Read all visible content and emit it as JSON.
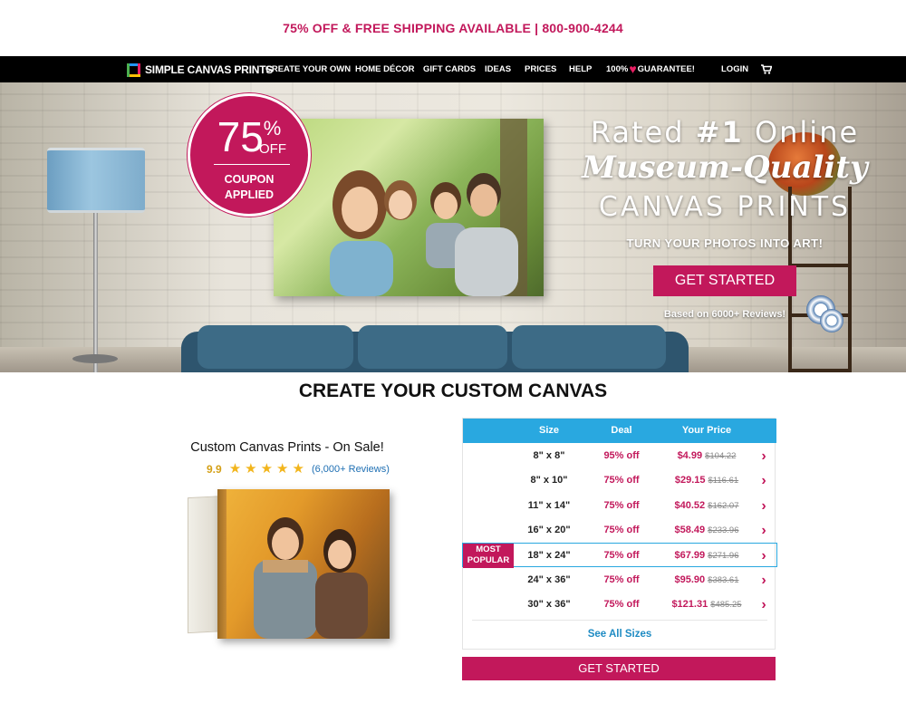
{
  "promo": {
    "text": "75% OFF & FREE SHIPPING AVAILABLE | 800-900-4244"
  },
  "nav": {
    "logo_text": "SIMPLE CANVAS PRINTS",
    "items": [
      "CREATE YOUR OWN",
      "HOME DÉCOR",
      "GIFT CARDS",
      "IDEAS",
      "PRICES",
      "HELP"
    ],
    "guarantee_prefix": "100%",
    "guarantee_suffix": "GUARANTEE!",
    "login": "LOGIN",
    "cart_icon": "cart-icon"
  },
  "hero": {
    "badge_number": "75",
    "badge_percent": "%",
    "badge_off": "OFF",
    "badge_coupon_line1": "COUPON",
    "badge_coupon_line2": "APPLIED",
    "line1_prefix": "Rated ",
    "line1_bold": "#1",
    "line1_suffix": " Online",
    "line2": "Museum-Quality",
    "line3": "CANVAS PRINTS",
    "tagline": "TURN YOUR PHOTOS INTO ART!",
    "cta": "GET STARTED",
    "reviews": "Based on 6000+ Reviews!"
  },
  "section_title": "CREATE YOUR CUSTOM CANVAS",
  "product": {
    "title": "Custom Canvas Prints - On Sale!",
    "rating_score": "9.9",
    "stars": 5,
    "review_count": "(6,000+ Reviews)"
  },
  "pricing": {
    "headers": {
      "size": "Size",
      "deal": "Deal",
      "price": "Your Price"
    },
    "rows": [
      {
        "size": "8\" x 8\"",
        "deal": "95% off",
        "price": "$4.99",
        "old": "$104.22",
        "popular": false
      },
      {
        "size": "8\" x 10\"",
        "deal": "75% off",
        "price": "$29.15",
        "old": "$116.61",
        "popular": false
      },
      {
        "size": "11\" x 14\"",
        "deal": "75% off",
        "price": "$40.52",
        "old": "$162.07",
        "popular": false
      },
      {
        "size": "16\" x 20\"",
        "deal": "75% off",
        "price": "$58.49",
        "old": "$233.96",
        "popular": false
      },
      {
        "size": "18\" x 24\"",
        "deal": "75% off",
        "price": "$67.99",
        "old": "$271.96",
        "popular": true
      },
      {
        "size": "24\" x 36\"",
        "deal": "75% off",
        "price": "$95.90",
        "old": "$383.61",
        "popular": false
      },
      {
        "size": "30\" x 36\"",
        "deal": "75% off",
        "price": "$121.31",
        "old": "$485.25",
        "popular": false
      }
    ],
    "popular_label_line1": "MOST",
    "popular_label_line2": "POPULAR",
    "see_all": "See All Sizes",
    "cta": "GET STARTED"
  },
  "colors": {
    "accent": "#c2185b",
    "table_header": "#29a8e0",
    "link": "#1e8bc3"
  }
}
